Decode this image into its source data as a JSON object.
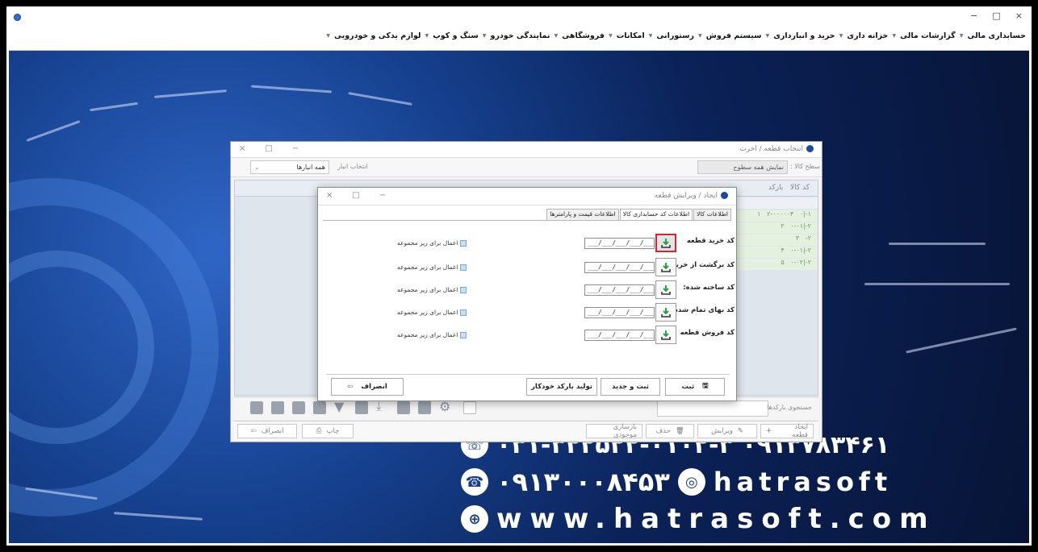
{
  "menu": {
    "items": [
      "حسابداری مالی",
      "گزارشات مالی",
      "خزانه داری",
      "خرید و انبارداری",
      "سیستم فروش",
      "رستورانی",
      "امکانات",
      "فروشگاهی",
      "نمایندگی خودرو",
      "سنگ و کوپ",
      "لوازم یدکی و خودرویی"
    ],
    "window_controls": [
      "−",
      "□",
      "×"
    ]
  },
  "back_window": {
    "title": "انتخاب قطعه / اخرت",
    "warehouse_label": "انتخاب انبار",
    "warehouse_value": "همه انبارها",
    "level_label": "سطح کالا :",
    "level_value": "نمایش همه سطوح",
    "grid_header": "کد کالا   بارکد",
    "grid_rows": [
      "۱-|۰   ۲-۰۰۰۰۰۴   ۱",
      "۲-|۰-۰۱   ۲",
      "۲-   ۳",
      "۲-|۰-۰۱   ۴",
      "۲-|۰-۰۲   ۵"
    ],
    "search_label": "جستجوی بارکدها",
    "footer": {
      "create": "ایجاد قطعه",
      "edit": "ویرایش",
      "delete": "حذف",
      "restock": "بازسازی موجودی",
      "print": "چاپ",
      "cancel": "انصراف"
    }
  },
  "dialog": {
    "title": "ایجاد / ویرایش قطعه",
    "tabs": [
      "اطلاعات کالا",
      "اطلاعات کد حسابداری کالا",
      "اطلاعات قیمت و پارامترها"
    ],
    "active_tab": "اطلاعات کد حسابداری کالا",
    "rows": [
      {
        "label": "کد خرید قطعه",
        "code": "___/___/___/___/___",
        "apply": "اعمال برای زیر مجموعه"
      },
      {
        "label": "کد برگشت از خرید:",
        "code": "___/___/___/___/___",
        "apply": "اعمال برای زیر مجموعه"
      },
      {
        "label": "کد ساخته شده:",
        "code": "___/___/___/___/___",
        "apply": "اعمال برای زیر مجموعه"
      },
      {
        "label": "کد بهای تمام شده :",
        "code": "___/___/___/___/___",
        "apply": "اعمال برای زیر مجموعه"
      },
      {
        "label": "کد فروش قطعه",
        "code": "___/___/___/___/___",
        "apply": "اعمال برای زیر مجموعه"
      }
    ],
    "buttons": {
      "save": "ثبت",
      "save_new": "ثبت و جدید",
      "auto_barcode": "تولید بارکد خودکار",
      "cancel": "انصراف"
    }
  },
  "brand": {
    "phone": "۰۳۱-۳۲۲۵۲۲-۰۱۰۲-۳   ۰۹۱۳۷۸۳۴۶۱",
    "mobile": "۰۹۱۳۰۰۰۸۴۵۳",
    "instagram": "hatrasoft",
    "website": "www.hatrasoft.com"
  },
  "colors": {
    "highlight": "#d3262f",
    "download_arrow": "#2e9e4f",
    "bg_blue": "#0b2258"
  }
}
